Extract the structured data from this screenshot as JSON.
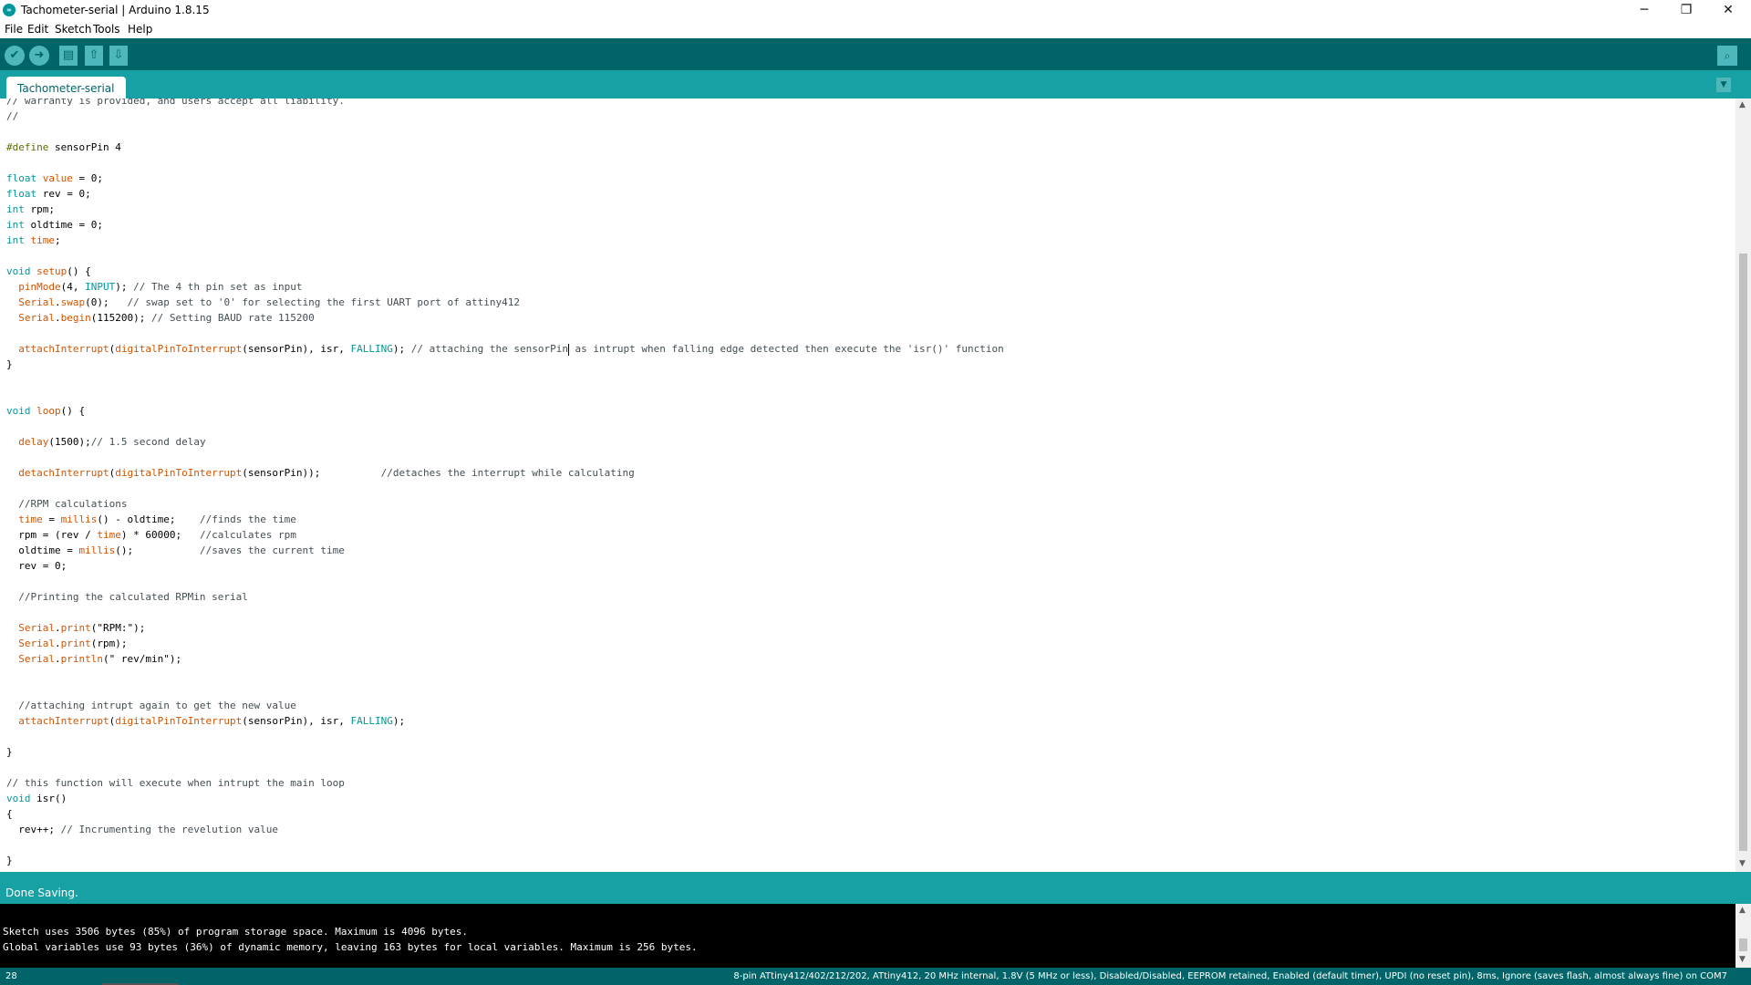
{
  "window": {
    "title": "Tachometer-serial | Arduino 1.8.15",
    "icon": "arduino-logo-icon",
    "minimize_symbol": "─",
    "maximize_symbol": "❐",
    "close_symbol": "✕"
  },
  "menu": [
    "File",
    "Edit",
    "Sketch",
    "Tools",
    "Help"
  ],
  "toolbar": {
    "verify_icon": "✔",
    "upload_icon": "➜",
    "new_icon": "▤",
    "open_icon": "⇧",
    "save_icon": "⇩",
    "serial_monitor_icon": "⌕"
  },
  "tab": {
    "label": "Tachometer-serial",
    "menu_icon": "▼"
  },
  "code_lines": [
    "// warranty is provided, and users accept all liability.",
    "//",
    "",
    "#define sensorPin 4",
    "",
    "float value = 0;",
    "float rev = 0;",
    "int rpm;",
    "int oldtime = 0;",
    "int time;",
    "",
    "void setup() {",
    "  pinMode(4, INPUT); // The 4 th pin set as input",
    "  Serial.swap(0);   // swap set to '0' for selecting the first UART port of attiny412",
    "  Serial.begin(115200); // Setting BAUD rate 115200",
    "",
    "  attachInterrupt(digitalPinToInterrupt(sensorPin), isr, FALLING); // attaching the sensorPin as intrupt when falling edge detected then execute the 'isr()' function",
    "}",
    "",
    "",
    "void loop() {",
    "",
    "  delay(1500);// 1.5 second delay",
    "",
    "  detachInterrupt(digitalPinToInterrupt(sensorPin));          //detaches the interrupt while calculating",
    "",
    "  //RPM calculations",
    "  time = millis() - oldtime;    //finds the time",
    "  rpm = (rev / time) * 60000;   //calculates rpm",
    "  oldtime = millis();           //saves the current time",
    "  rev = 0;",
    "",
    "  //Printing the calculated RPMin serial",
    "",
    "  Serial.print(\"RPM:\");",
    "  Serial.print(rpm);",
    "  Serial.println(\" rev/min\");",
    "",
    "",
    "  //attaching intrupt again to get the new value",
    "  attachInterrupt(digitalPinToInterrupt(sensorPin), isr, FALLING);",
    "",
    "}",
    "",
    "// this function will execute when intrupt the main loop",
    "void isr()",
    "{",
    "  rev++; // Incrumenting the revelution value",
    "",
    "}"
  ],
  "status": "Done Saving.",
  "console": [
    "Sketch uses 3506 bytes (85%) of program storage space. Maximum is 4096 bytes.",
    "Global variables use 93 bytes (36%) of dynamic memory, leaving 163 bytes for local variables. Maximum is 256 bytes."
  ],
  "bottom": {
    "line_number": "28",
    "board_info": "8-pin ATtiny412/402/212/202, ATtiny412, 20 MHz internal, 1.8V (5 MHz or less), Disabled/Disabled, EEPROM retained, Enabled (default timer), UPDI (no reset pin), 8ms, Ignore (saves flash, almost always fine) on COM7"
  },
  "colors": {
    "toolbar": "#006468",
    "tabbar": "#17a1a5",
    "keyword": "#00979c",
    "function": "#d35400",
    "comment": "#434f54",
    "preprocessor": "#5e6d03"
  }
}
